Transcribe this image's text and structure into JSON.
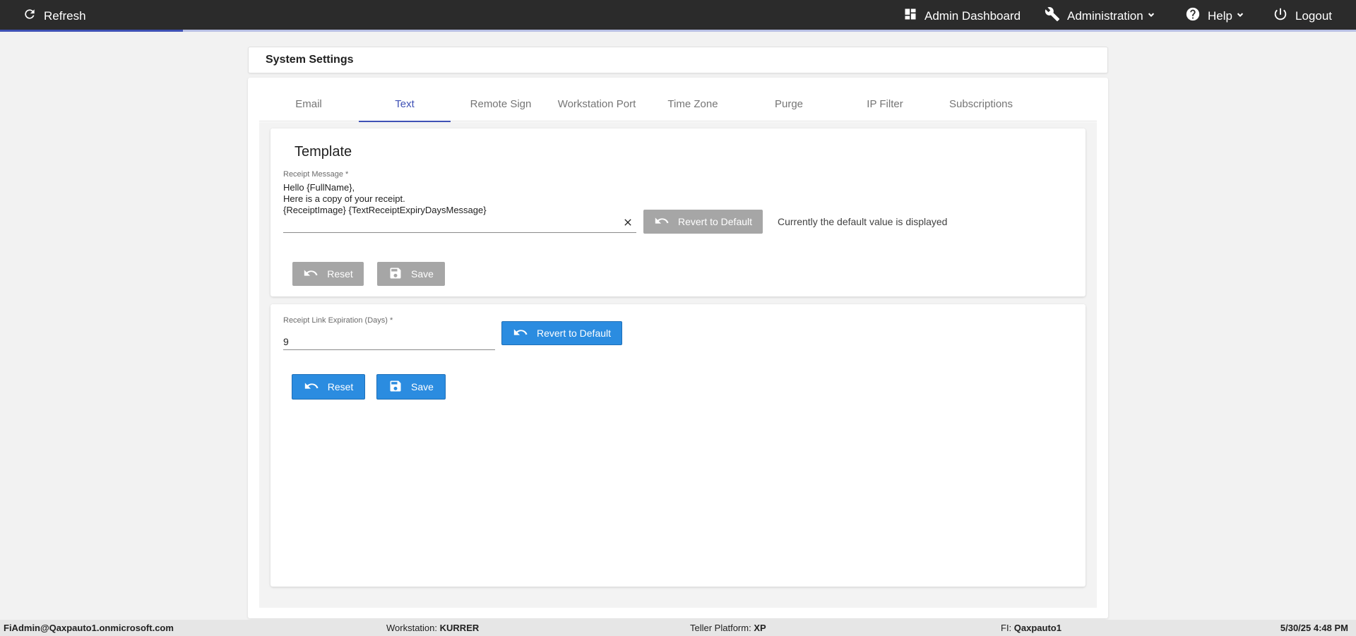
{
  "topbar": {
    "refresh_label": "Refresh",
    "admin_dashboard_label": "Admin Dashboard",
    "administration_label": "Administration",
    "help_label": "Help",
    "logout_label": "Logout",
    "progress_fraction": 0.135
  },
  "page": {
    "title": "System Settings"
  },
  "tabs": [
    {
      "label": "Email",
      "active": false
    },
    {
      "label": "Text",
      "active": true
    },
    {
      "label": "Remote Sign",
      "active": false
    },
    {
      "label": "Workstation Port",
      "active": false
    },
    {
      "label": "Time Zone",
      "active": false
    },
    {
      "label": "Purge",
      "active": false
    },
    {
      "label": "IP Filter",
      "active": false
    },
    {
      "label": "Subscriptions",
      "active": false
    }
  ],
  "template_panel": {
    "title": "Template",
    "receipt_message": {
      "label": "Receipt Message *",
      "lines": [
        "Hello {FullName},",
        "Here is a copy of your receipt.",
        "{ReceiptImage} {TextReceiptExpiryDaysMessage}"
      ]
    },
    "revert_label": "Revert to Default",
    "status_text": "Currently the default value is displayed",
    "reset_label": "Reset",
    "save_label": "Save"
  },
  "expiration_panel": {
    "label": "Receipt Link Expiration (Days) *",
    "value": "9",
    "revert_label": "Revert to Default",
    "reset_label": "Reset",
    "save_label": "Save"
  },
  "footer": {
    "user": "FiAdmin@Qaxpauto1.onmicrosoft.com",
    "workstation_label": "Workstation:",
    "workstation_value": "KURRER",
    "teller_label": "Teller Platform:",
    "teller_value": "XP",
    "fi_label": "FI:",
    "fi_value": "Qaxpauto1",
    "datetime": "5/30/25 4:48 PM"
  },
  "colors": {
    "topbar_bg": "#2b2b2b",
    "accent": "#3f51b5",
    "primary_button": "#2b8ce0",
    "disabled_button": "#a6a6a6"
  }
}
